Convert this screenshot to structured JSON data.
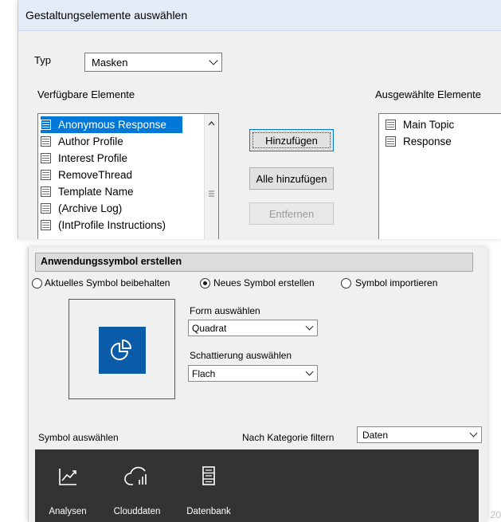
{
  "dialog1": {
    "title": "Gestaltungselemente auswählen",
    "typ_label": "Typ",
    "typ_value": "Masken",
    "available_label": "Verfügbare Elemente",
    "selected_label": "Ausgewählte Elemente",
    "available_items": [
      {
        "label": "Anonymous Response",
        "selected": true
      },
      {
        "label": "Author Profile"
      },
      {
        "label": "Interest Profile"
      },
      {
        "label": "RemoveThread"
      },
      {
        "label": "Template Name"
      },
      {
        "label": "(Archive Log)"
      },
      {
        "label": "(IntProfile Instructions)"
      }
    ],
    "selected_items": [
      "Main Topic",
      "Response"
    ],
    "buttons": {
      "add": "Hinzufügen",
      "add_all": "Alle hinzufügen",
      "remove": "Entfernen"
    }
  },
  "dialog2": {
    "title": "Anwendungssymbol erstellen",
    "radio_keep": "Aktuelles Symbol beibehalten",
    "radio_new": "Neues Symbol erstellen",
    "radio_import": "Symbol importieren",
    "selected_radio": "new",
    "form_label": "Form auswählen",
    "form_value": "Quadrat",
    "shade_label": "Schattierung auswählen",
    "shade_value": "Flach",
    "symbol_label": "Symbol auswählen",
    "category_label": "Nach Kategorie filtern",
    "category_value": "Daten",
    "gallery": [
      {
        "label": "Analysen",
        "icon": "chart-icon"
      },
      {
        "label": "Clouddaten",
        "icon": "cloud-data-icon"
      },
      {
        "label": "Datenbank",
        "icon": "database-icon"
      }
    ],
    "icon_color": "#0a5ca8"
  },
  "page_number": "20"
}
